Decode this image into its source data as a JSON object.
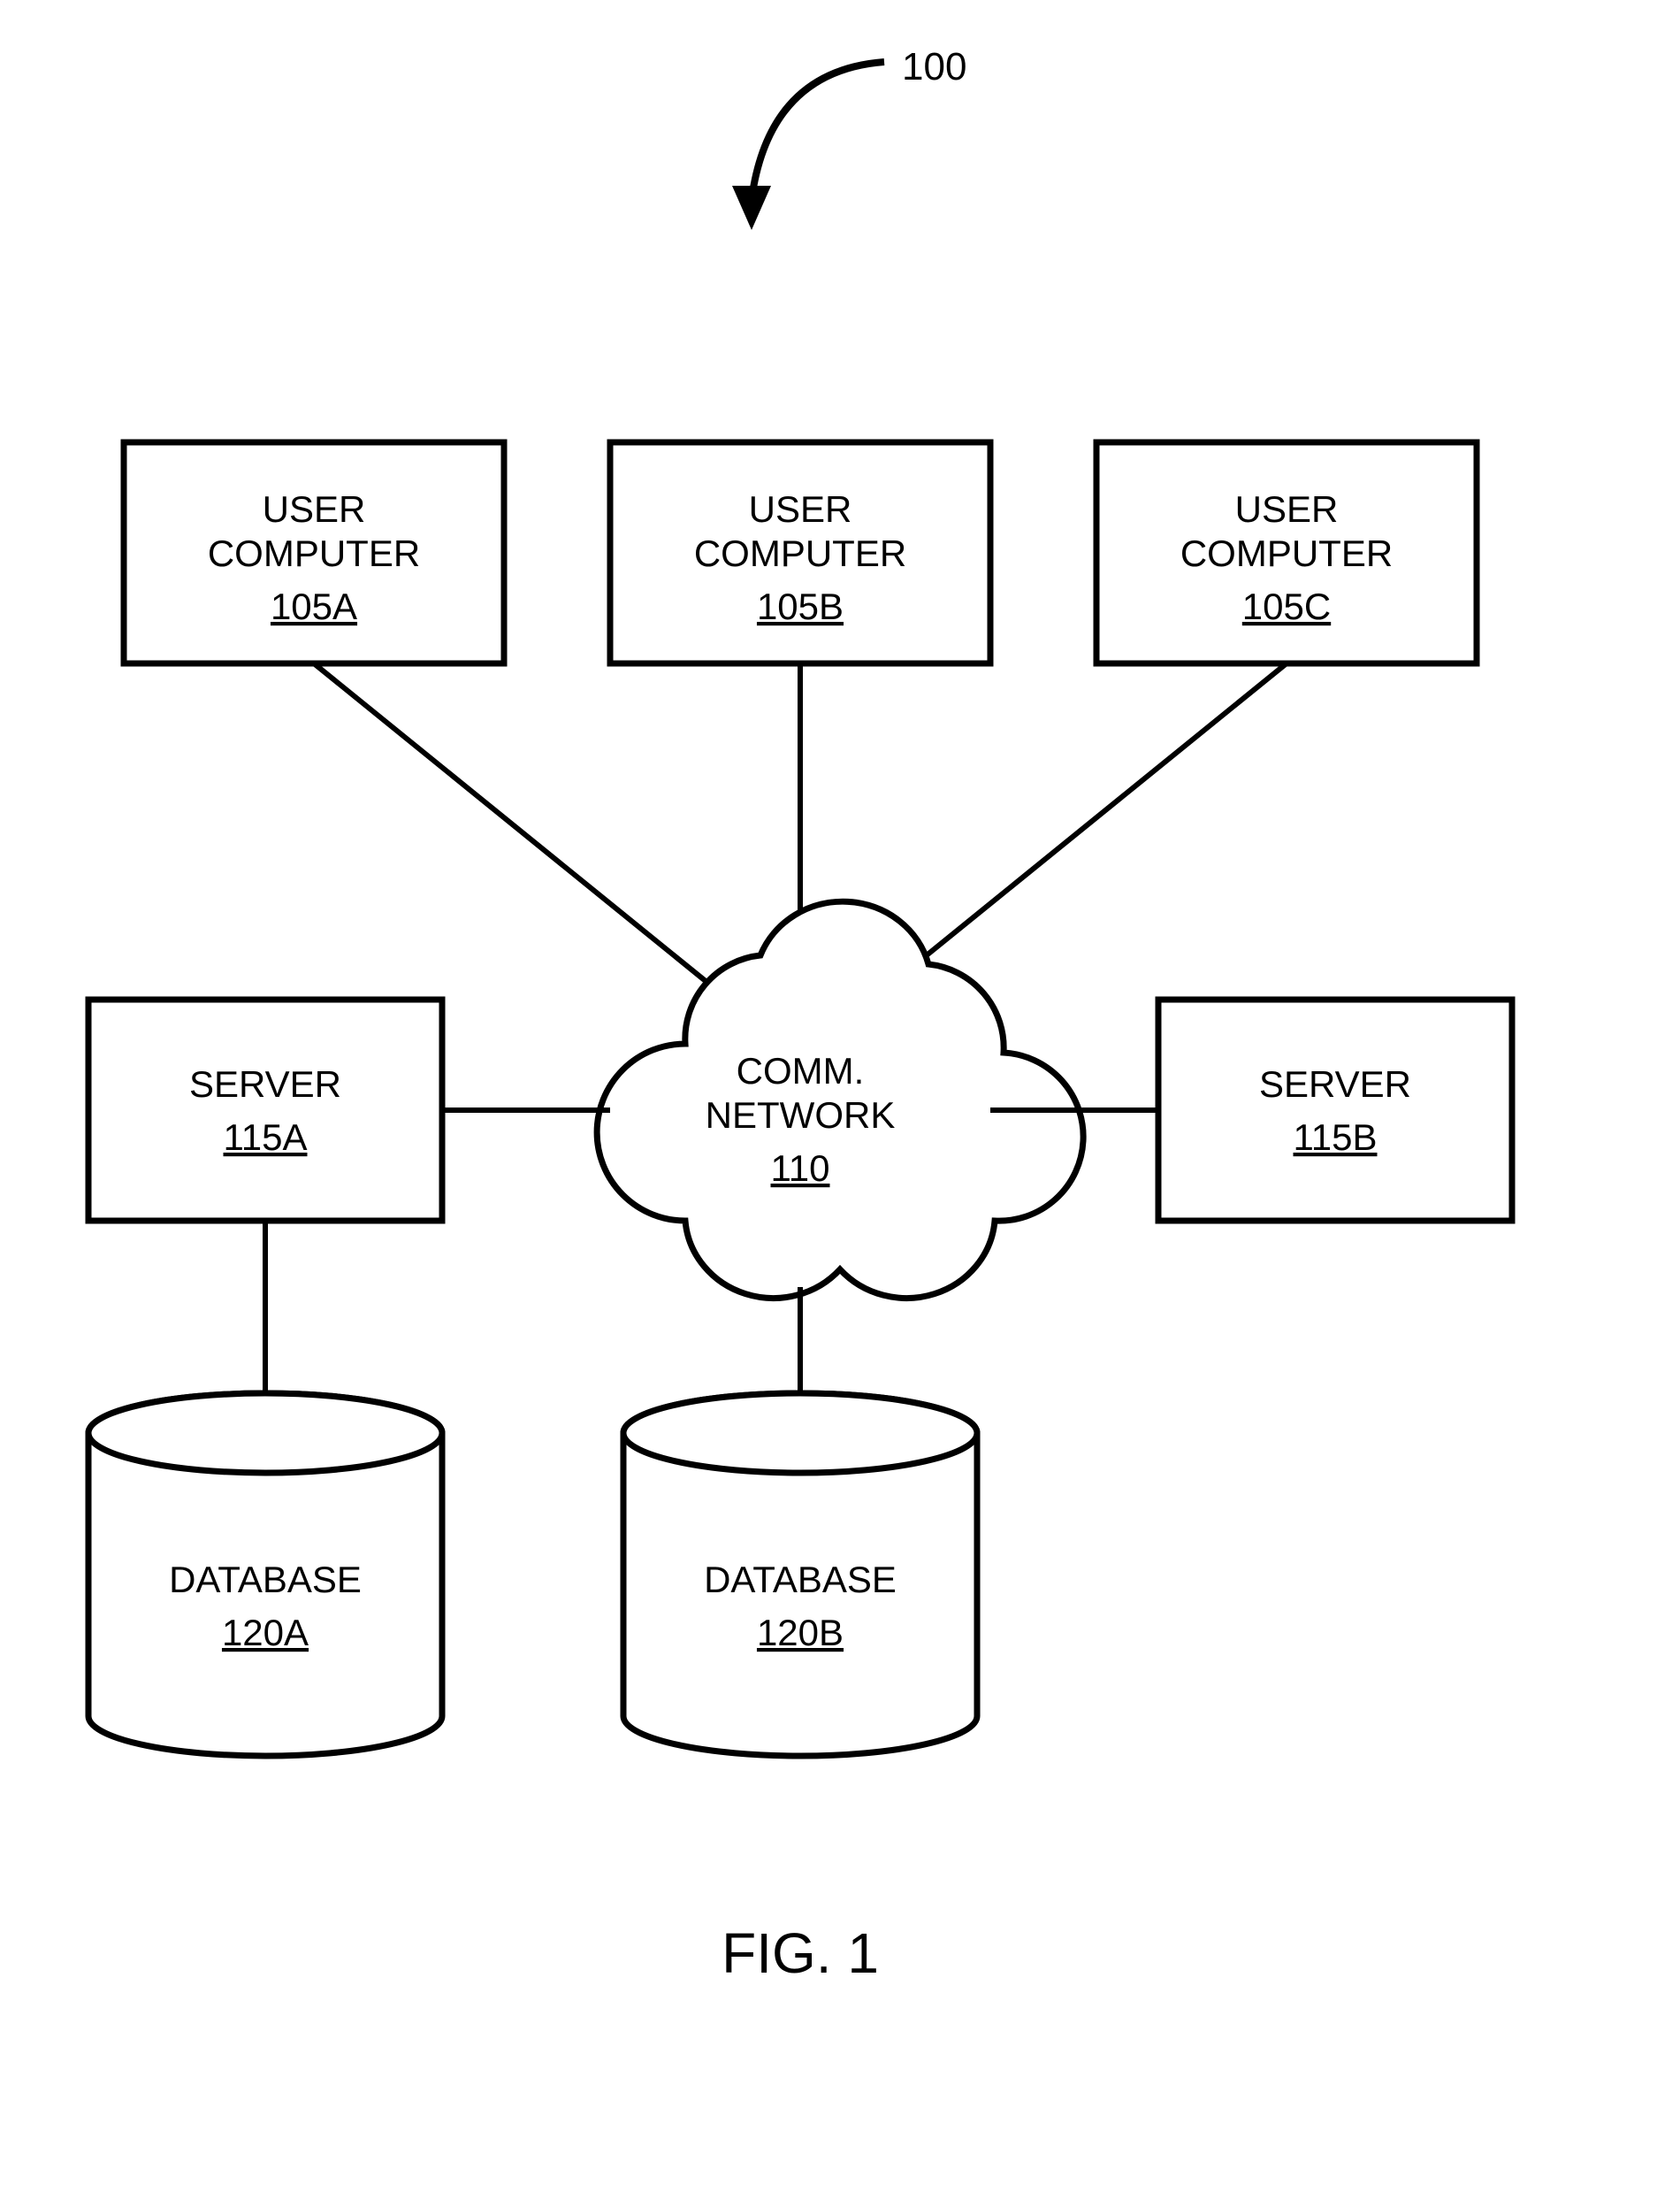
{
  "diagram": {
    "system_ref": "100",
    "figure_label": "FIG. 1",
    "nodes": {
      "user_a": {
        "label": "USER COMPUTER",
        "ref": "105A"
      },
      "user_b": {
        "label": "USER COMPUTER",
        "ref": "105B"
      },
      "user_c": {
        "label": "USER COMPUTER",
        "ref": "105C"
      },
      "server_a": {
        "label": "SERVER",
        "ref": "115A"
      },
      "server_b": {
        "label": "SERVER",
        "ref": "115B"
      },
      "network": {
        "label_line1": "COMM.",
        "label_line2": "NETWORK",
        "ref": "110"
      },
      "db_a": {
        "label": "DATABASE",
        "ref": "120A"
      },
      "db_b": {
        "label": "DATABASE",
        "ref": "120B"
      }
    }
  }
}
